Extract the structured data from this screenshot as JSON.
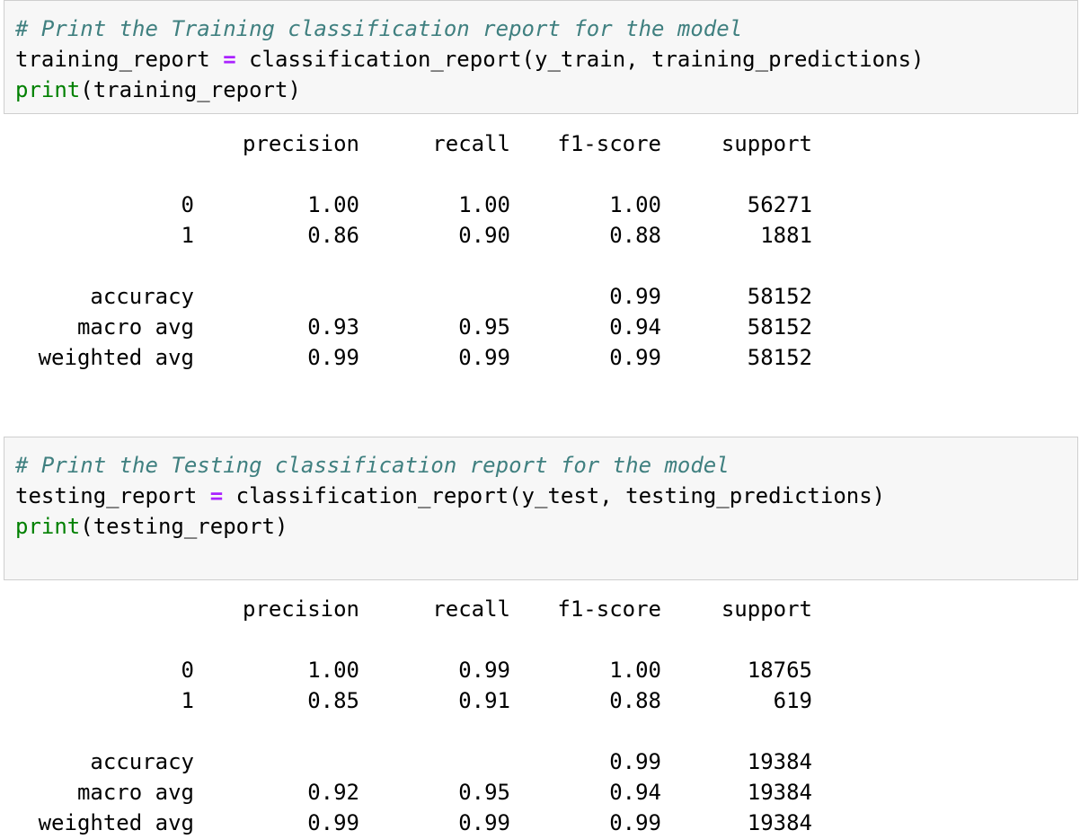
{
  "cells": [
    {
      "comment": "# Print the Training classification report for the model",
      "line2": {
        "var": "training_report",
        "op": "=",
        "rest": "classification_report(y_train, training_predictions)"
      },
      "line3": {
        "fn": "print",
        "args": "(training_report)"
      },
      "output": {
        "headers": [
          "precision",
          "recall",
          "f1-score",
          "support"
        ],
        "rows": [
          {
            "label": "0",
            "precision": "1.00",
            "recall": "1.00",
            "f1": "1.00",
            "support": "56271"
          },
          {
            "label": "1",
            "precision": "0.86",
            "recall": "0.90",
            "f1": "0.88",
            "support": "1881"
          }
        ],
        "summary": [
          {
            "label": "accuracy",
            "precision": "",
            "recall": "",
            "f1": "0.99",
            "support": "58152"
          },
          {
            "label": "macro avg",
            "precision": "0.93",
            "recall": "0.95",
            "f1": "0.94",
            "support": "58152"
          },
          {
            "label": "weighted avg",
            "precision": "0.99",
            "recall": "0.99",
            "f1": "0.99",
            "support": "58152"
          }
        ]
      }
    },
    {
      "comment": "# Print the Testing classification report for the model",
      "line2": {
        "var": "testing_report",
        "op": "=",
        "rest": "classification_report(y_test, testing_predictions)"
      },
      "line3": {
        "fn": "print",
        "args": "(testing_report)"
      },
      "output": {
        "headers": [
          "precision",
          "recall",
          "f1-score",
          "support"
        ],
        "rows": [
          {
            "label": "0",
            "precision": "1.00",
            "recall": "0.99",
            "f1": "1.00",
            "support": "18765"
          },
          {
            "label": "1",
            "precision": "0.85",
            "recall": "0.91",
            "f1": "0.88",
            "support": "619"
          }
        ],
        "summary": [
          {
            "label": "accuracy",
            "precision": "",
            "recall": "",
            "f1": "0.99",
            "support": "19384"
          },
          {
            "label": "macro avg",
            "precision": "0.92",
            "recall": "0.95",
            "f1": "0.94",
            "support": "19384"
          },
          {
            "label": "weighted avg",
            "precision": "0.99",
            "recall": "0.99",
            "f1": "0.99",
            "support": "19384"
          }
        ]
      }
    }
  ],
  "colors": {
    "comment": "#408080",
    "operator": "#aa22ff",
    "builtin": "#008000",
    "cell_background": "#f7f7f7",
    "cell_border": "#cfcfcf"
  }
}
